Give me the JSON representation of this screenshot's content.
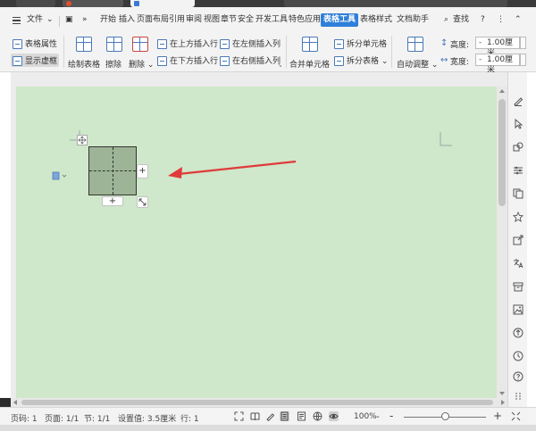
{
  "menu": {
    "file": "文件",
    "tabs": [
      "开始",
      "插入",
      "页面布局",
      "引用",
      "审阅",
      "视图",
      "章节",
      "安全",
      "开发工具",
      "特色应用",
      "表格工具",
      "表格样式",
      "文档助手"
    ],
    "active_tab": "表格工具",
    "search": "查找",
    "help": "?"
  },
  "ribbon": {
    "table_props": "表格属性",
    "show_gridlines": "显示虚框",
    "draw_table": "绘制表格",
    "eraser": "擦除",
    "delete": "删除",
    "insert_above": "在上方插入行",
    "insert_below": "在下方插入行",
    "insert_left": "在左侧插入列",
    "insert_right": "在右侧插入列",
    "merge_cells": "合并单元格",
    "split_cells": "拆分单元格",
    "split_table": "拆分表格",
    "auto_fit": "自动调整",
    "height_label": "高度:",
    "height_value": "1.00厘米",
    "width_label": "宽度:",
    "width_value": "1.00厘米",
    "minus": "-"
  },
  "canvas": {
    "add_col": "+",
    "add_row": "+"
  },
  "status": {
    "page_count": "页码: 1",
    "page": "页面: 1/1",
    "section": "节: 1/1",
    "setting": "设置值: 3.5厘米",
    "row": "行: 1",
    "zoom": "100%",
    "zoom_minus": "-",
    "zoom_plus": "+"
  },
  "colors": {
    "page_bg": "#cfe7ca",
    "table_fill": "#9db596",
    "active_tab": "#2e7fd9",
    "arrow": "#e03a3a"
  }
}
